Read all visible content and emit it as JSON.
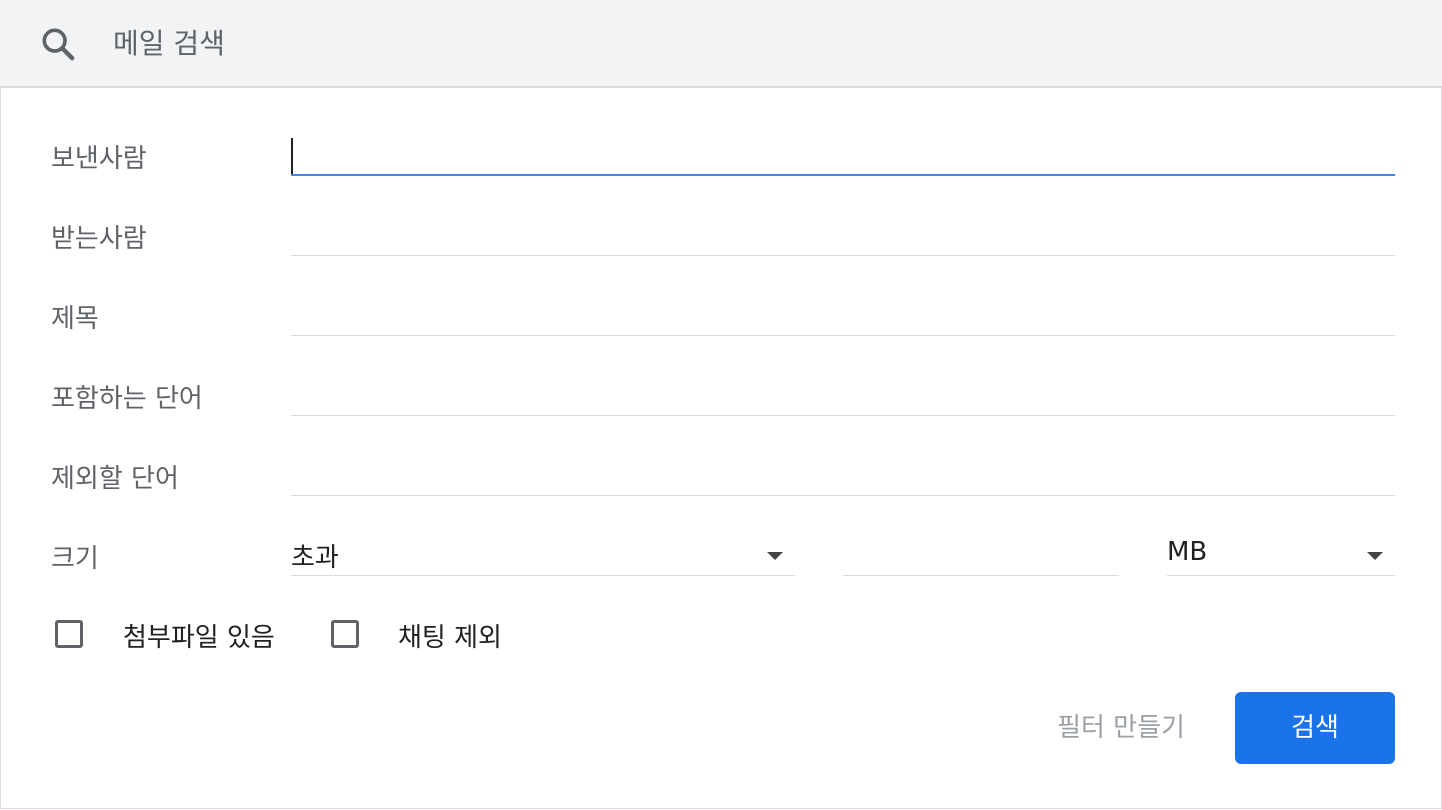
{
  "search": {
    "placeholder": "메일 검색",
    "icon": "search-icon"
  },
  "form": {
    "from_label": "보낸사람",
    "to_label": "받는사람",
    "subject_label": "제목",
    "has_words_label": "포함하는 단어",
    "doesnt_have_label": "제외할 단어",
    "size_label": "크기",
    "from_value": "",
    "to_value": "",
    "subject_value": "",
    "has_words_value": "",
    "doesnt_have_value": "",
    "size_operator": "초과",
    "size_value": "",
    "size_unit": "MB"
  },
  "checkboxes": {
    "has_attachment_label": "첨부파일 있음",
    "has_attachment_checked": false,
    "exclude_chats_label": "채팅 제외",
    "exclude_chats_checked": false
  },
  "actions": {
    "create_filter_label": "필터 만들기",
    "search_label": "검색"
  },
  "colors": {
    "primary_button": "#1a73e8",
    "focus_underline": "#4285f4",
    "search_bar_bg": "#f1f3f4",
    "disabled_text": "#9aa0a6"
  }
}
